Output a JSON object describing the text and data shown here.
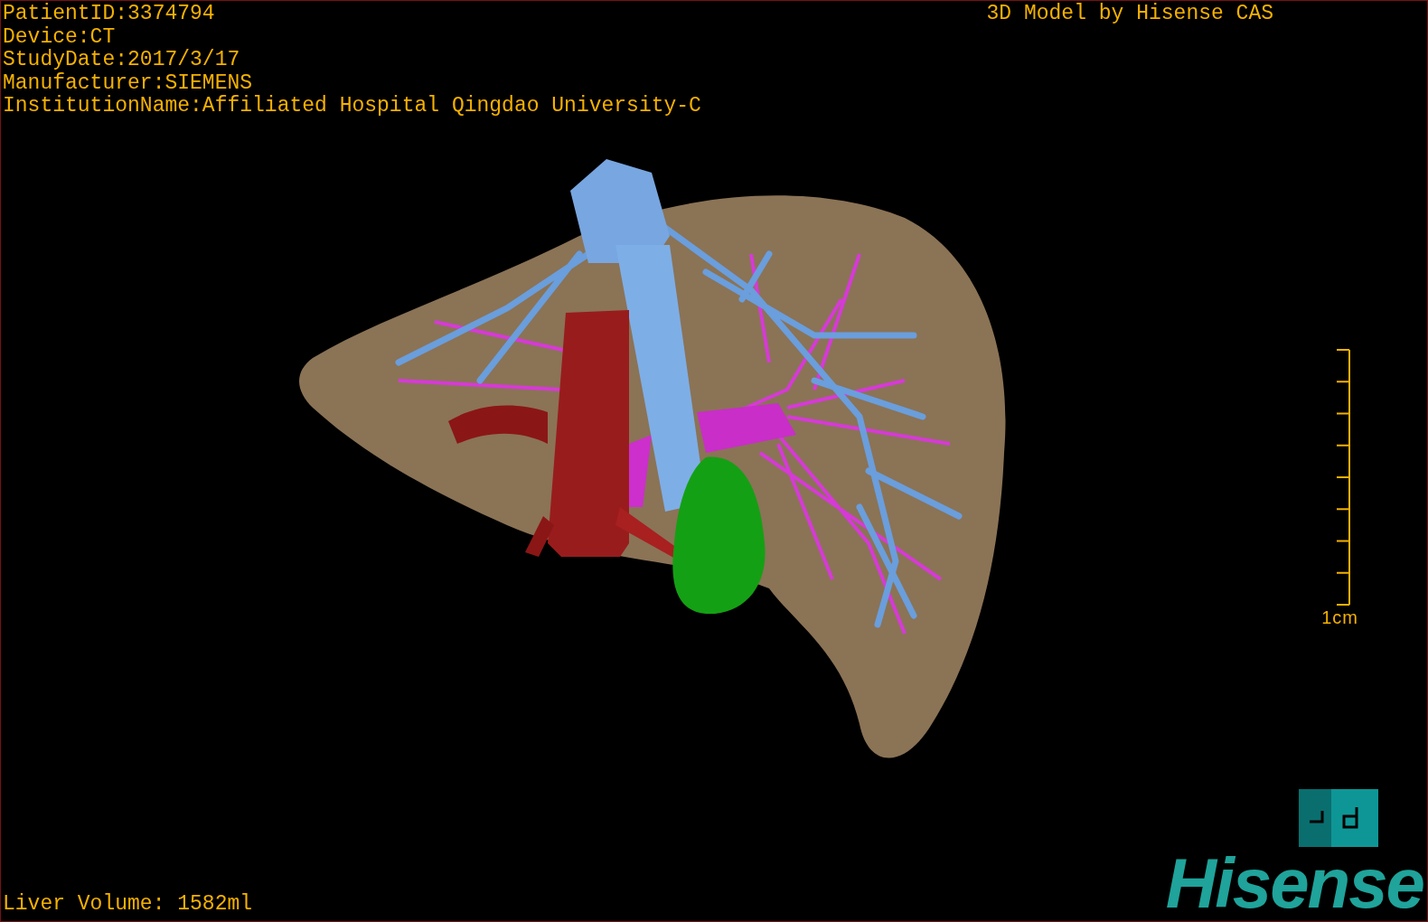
{
  "viewport": {
    "info_lines": [
      "PatientID:3374794",
      "Device:CT",
      "StudyDate:2017/3/17",
      "Manufacturer:SIEMENS",
      "InstitutionName:Affiliated Hospital Qingdao University-C"
    ],
    "title": "3D Model by Hisense CAS",
    "scale_bar": {
      "label": "1cm"
    },
    "liver_volume": "Liver Volume: 1582ml",
    "brand_logo": "Hisense"
  }
}
